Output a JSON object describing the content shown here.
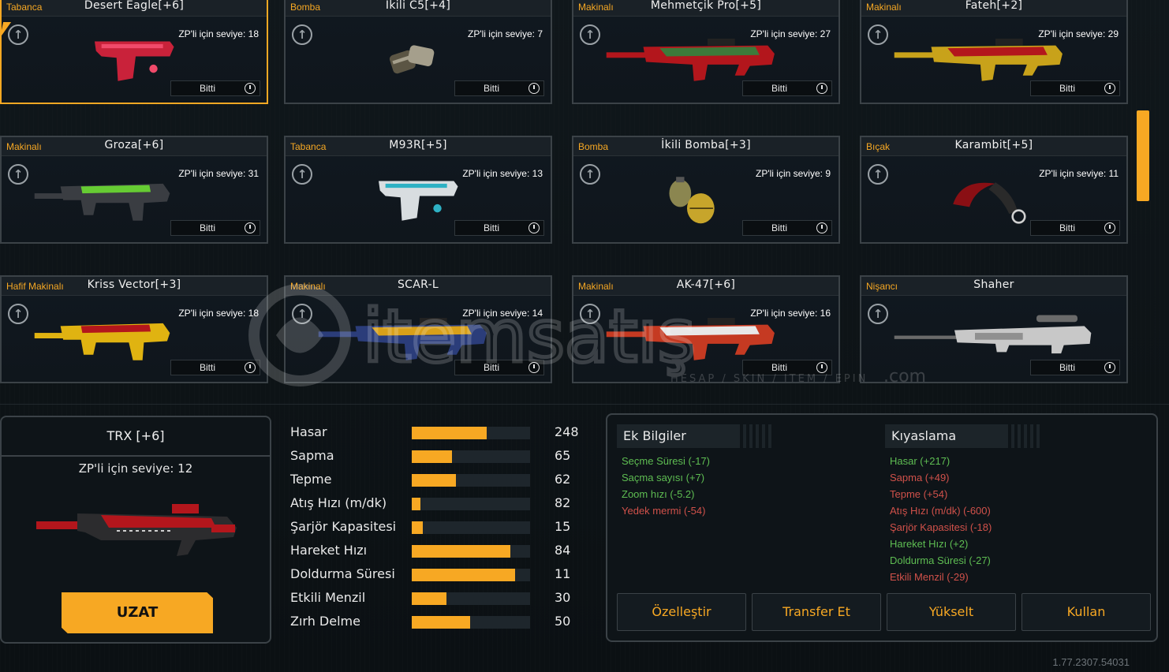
{
  "status_label": "Bitti",
  "cards": [
    {
      "category": "Tabanca",
      "name": "Desert Eagle[+6]",
      "level": "ZP'li için seviye: 18",
      "selected": true,
      "weapon": "pistol",
      "colors": [
        "#c9223a",
        "#f04a6a"
      ]
    },
    {
      "category": "Bomba",
      "name": "İkili C5[+4]",
      "level": "ZP'li için seviye: 7",
      "weapon": "c5",
      "colors": [
        "#5b5544",
        "#a59f8c"
      ]
    },
    {
      "category": "Makinalı",
      "name": "Mehmetçik Pro[+5]",
      "level": "ZP'li için seviye: 27",
      "weapon": "rifle",
      "colors": [
        "#b3161c",
        "#3d7a3a"
      ]
    },
    {
      "category": "Makinalı",
      "name": "Fateh[+2]",
      "level": "ZP'li için seviye: 29",
      "weapon": "rifle",
      "colors": [
        "#c8a21a",
        "#b3161c"
      ]
    },
    {
      "category": "Makinalı",
      "name": "Groza[+6]",
      "level": "ZP'li için seviye: 31",
      "weapon": "smg",
      "colors": [
        "#3a3d42",
        "#66cc33"
      ]
    },
    {
      "category": "Tabanca",
      "name": "M93R[+5]",
      "level": "ZP'li için seviye: 13",
      "weapon": "pistol",
      "colors": [
        "#d8dde0",
        "#2eb1c4"
      ]
    },
    {
      "category": "Bomba",
      "name": "İkili Bomba[+3]",
      "level": "ZP'li için seviye: 9",
      "weapon": "grenade",
      "colors": [
        "#8b8650",
        "#c7a52b"
      ]
    },
    {
      "category": "Bıçak",
      "name": "Karambit[+5]",
      "level": "ZP'li için seviye: 11",
      "weapon": "knife",
      "colors": [
        "#8a0f14",
        "#2a2a2a"
      ]
    },
    {
      "category": "Hafif Makinalı",
      "name": "Kriss Vector[+3]",
      "level": "ZP'li için seviye: 18",
      "weapon": "smg",
      "colors": [
        "#e0b311",
        "#b3161c"
      ]
    },
    {
      "category": "Makinalı",
      "name": "SCAR-L",
      "level": "ZP'li için seviye: 14",
      "weapon": "rifle",
      "colors": [
        "#2b3d7a",
        "#d8a019"
      ]
    },
    {
      "category": "Makinalı",
      "name": "AK-47[+6]",
      "level": "ZP'li için seviye: 16",
      "weapon": "rifle",
      "colors": [
        "#c53a22",
        "#e8e8e8"
      ]
    },
    {
      "category": "Nişancı",
      "name": "Shaher",
      "level": null,
      "weapon": "sniper",
      "colors": [
        "#c8c8c8",
        "#6a6a6a"
      ]
    }
  ],
  "watermark": {
    "brand": "itemsatış",
    "tagline": "HESAP / SKIN / ITEM / EPIN",
    "suffix": ".com"
  },
  "selected": {
    "name": "TRX [+6]",
    "level": "ZP'li için seviye: 12",
    "extend_label": "UZAT",
    "colors": [
      "#b3161c",
      "#3a3a3a"
    ]
  },
  "stats": [
    {
      "label": "Hasar",
      "value": "248",
      "fill": 0.63
    },
    {
      "label": "Sapma",
      "value": "65",
      "fill": 0.34
    },
    {
      "label": "Tepme",
      "value": "62",
      "fill": 0.37
    },
    {
      "label": "Atış Hızı (m/dk)",
      "value": "82",
      "fill": 0.07
    },
    {
      "label": "Şarjör Kapasitesi",
      "value": "15",
      "fill": 0.09
    },
    {
      "label": "Hareket Hızı",
      "value": "84",
      "fill": 0.83
    },
    {
      "label": "Doldurma Süresi",
      "value": "11",
      "fill": 0.87
    },
    {
      "label": "Etkili Menzil",
      "value": "30",
      "fill": 0.29
    },
    {
      "label": "Zırh Delme",
      "value": "50",
      "fill": 0.49
    }
  ],
  "extra_info": {
    "title": "Ek Bilgiler",
    "items": [
      {
        "text": "Seçme Süresi (-17)",
        "tone": "g"
      },
      {
        "text": "Saçma sayısı (+7)",
        "tone": "g"
      },
      {
        "text": "Zoom hızı (-5.2)",
        "tone": "g"
      },
      {
        "text": "Yedek mermi (-54)",
        "tone": "r"
      }
    ]
  },
  "compare": {
    "title": "Kıyaslama",
    "items": [
      {
        "text": "Hasar (+217)",
        "tone": "g"
      },
      {
        "text": "Sapma (+49)",
        "tone": "r"
      },
      {
        "text": "Tepme (+54)",
        "tone": "r"
      },
      {
        "text": "Atış Hızı (m/dk) (-600)",
        "tone": "r"
      },
      {
        "text": "Şarjör Kapasitesi (-18)",
        "tone": "r"
      },
      {
        "text": "Hareket Hızı (+2)",
        "tone": "g"
      },
      {
        "text": "Doldurma Süresi (-27)",
        "tone": "g"
      },
      {
        "text": "Etkili Menzil (-29)",
        "tone": "r"
      }
    ]
  },
  "actions": [
    "Özelleştir",
    "Transfer Et",
    "Yükselt",
    "Kullan"
  ],
  "version": "1.77.2307.54031",
  "accent_color": "#f7a823"
}
